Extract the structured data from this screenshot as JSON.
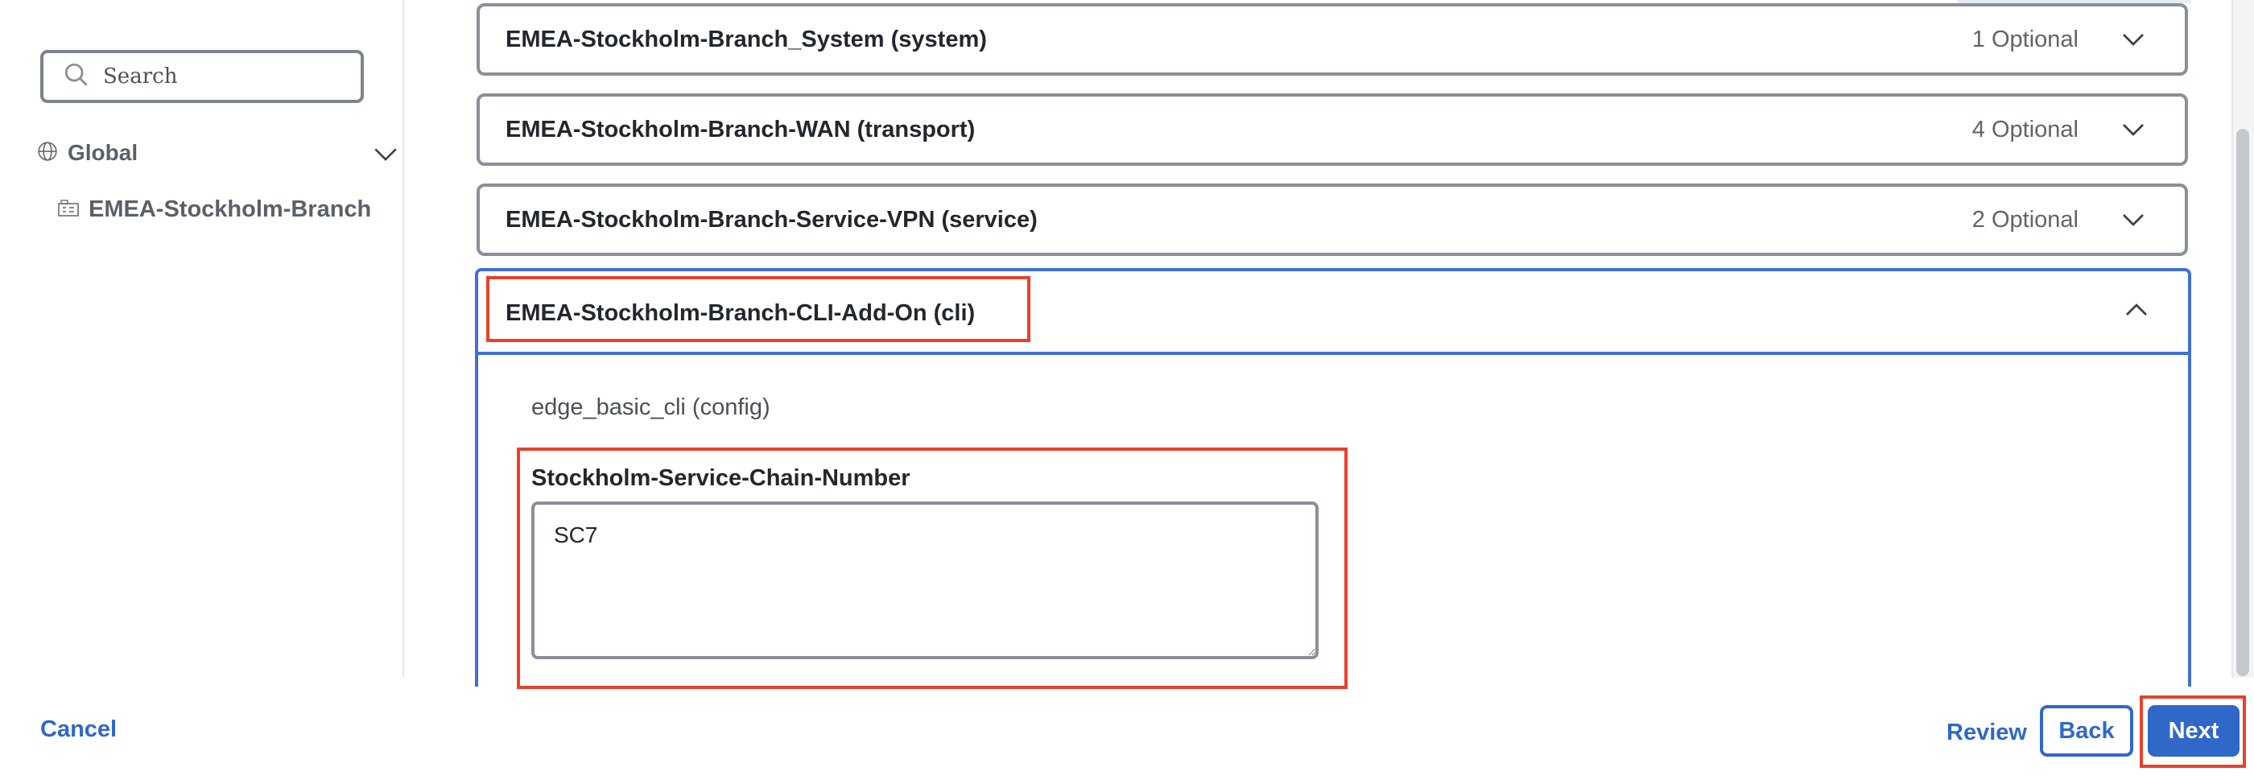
{
  "sidebar": {
    "search": {
      "placeholder": "Search",
      "value": ""
    },
    "tree": {
      "global_label": "Global",
      "site_label": "EMEA-Stockholm-Branch"
    }
  },
  "main": {
    "profiles": [
      {
        "title": "EMEA-Stockholm-Branch_System (system)",
        "optional": "1 Optional",
        "expanded": false
      },
      {
        "title": "EMEA-Stockholm-Branch-WAN (transport)",
        "optional": "4 Optional",
        "expanded": false
      },
      {
        "title": "EMEA-Stockholm-Branch-Service-VPN (service)",
        "optional": "2 Optional",
        "expanded": false
      },
      {
        "title": "EMEA-Stockholm-Branch-CLI-Add-On (cli)",
        "optional": "",
        "expanded": true
      }
    ],
    "expanded_section": {
      "section_label": "edge_basic_cli (config)",
      "field_label": "Stockholm-Service-Chain-Number",
      "field_value": "SC7"
    }
  },
  "footer": {
    "cancel_label": "Cancel",
    "review_label": "Review",
    "back_label": "Back",
    "next_label": "Next"
  },
  "colors": {
    "accent": "#2f68c9",
    "expanded_border": "#3f6fd8",
    "annotation": "#e8412a"
  },
  "icons": [
    "search-icon",
    "globe-icon",
    "chevron-down-icon",
    "building-icon",
    "chevron-up-icon"
  ]
}
